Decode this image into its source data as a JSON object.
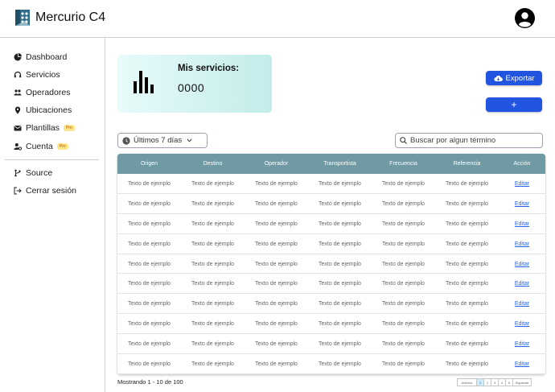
{
  "app": {
    "title": "Mercurio C4"
  },
  "sidebar": {
    "items": [
      {
        "label": "Dashboard",
        "icon": "pie-chart-icon",
        "badge": ""
      },
      {
        "label": "Servicios",
        "icon": "headset-icon",
        "badge": ""
      },
      {
        "label": "Operadores",
        "icon": "users-icon",
        "badge": ""
      },
      {
        "label": "Ubicaciones",
        "icon": "location-pin-icon",
        "badge": ""
      },
      {
        "label": "Plantillas",
        "icon": "envelope-icon",
        "badge": "Pro"
      },
      {
        "label": "Cuenta",
        "icon": "user-gear-icon",
        "badge": "Pro"
      }
    ],
    "footer_items": [
      {
        "label": "Source",
        "icon": "branch-icon"
      },
      {
        "label": "Cerrar sesión",
        "icon": "sign-out-icon"
      }
    ]
  },
  "stat": {
    "label": "Mis servicios:",
    "value": "0000"
  },
  "buttons": {
    "export_label": "Exportar",
    "add_label": "+"
  },
  "filter": {
    "value": "Últimos 7 días"
  },
  "search": {
    "placeholder": "Buscar por algun término"
  },
  "table": {
    "columns": [
      "Origen",
      "Destino",
      "Operador",
      "Transportista",
      "Frecuencia",
      "Referencia",
      "Acción"
    ],
    "rows": [
      [
        "Texto de ejemplo",
        "Texto de ejemplo",
        "Texto de ejemplo",
        "Texto de ejemplo",
        "Texto de ejemplo",
        "Texto de ejemplo",
        "Editar"
      ],
      [
        "Texto de ejemplo",
        "Texto de ejemplo",
        "Texto de ejemplo",
        "Texto de ejemplo",
        "Texto de ejemplo",
        "Texto de ejemplo",
        "Editar"
      ],
      [
        "Texto de ejemplo",
        "Texto de ejemplo",
        "Texto de ejemplo",
        "Texto de ejemplo",
        "Texto de ejemplo",
        "Texto de ejemplo",
        "Editar"
      ],
      [
        "Texto de ejemplo",
        "Texto de ejemplo",
        "Texto de ejemplo",
        "Texto de ejemplo",
        "Texto de ejemplo",
        "Texto de ejemplo",
        "Editar"
      ],
      [
        "Texto de ejemplo",
        "Texto de ejemplo",
        "Texto de ejemplo",
        "Texto de ejemplo",
        "Texto de ejemplo",
        "Texto de ejemplo",
        "Editar"
      ],
      [
        "Texto de ejemplo",
        "Texto de ejemplo",
        "Texto de ejemplo",
        "Texto de ejemplo",
        "Texto de ejemplo",
        "Texto de ejemplo",
        "Editar"
      ],
      [
        "Texto de ejemplo",
        "Texto de ejemplo",
        "Texto de ejemplo",
        "Texto de ejemplo",
        "Texto de ejemplo",
        "Texto de ejemplo",
        "Editar"
      ],
      [
        "Texto de ejemplo",
        "Texto de ejemplo",
        "Texto de ejemplo",
        "Texto de ejemplo",
        "Texto de ejemplo",
        "Texto de ejemplo",
        "Editar"
      ],
      [
        "Texto de ejemplo",
        "Texto de ejemplo",
        "Texto de ejemplo",
        "Texto de ejemplo",
        "Texto de ejemplo",
        "Texto de ejemplo",
        "Editar"
      ],
      [
        "Texto de ejemplo",
        "Texto de ejemplo",
        "Texto de ejemplo",
        "Texto de ejemplo",
        "Texto de ejemplo",
        "Texto de ejemplo",
        "Editar"
      ]
    ]
  },
  "pagination": {
    "summary": "Mostrando 1 - 10 de 100",
    "prev_label": "Anterior",
    "pages": [
      "1",
      "2",
      "3",
      "4",
      "5"
    ],
    "current_page": "1",
    "next_label": "Siguiente"
  },
  "colors": {
    "accent": "#2155e0",
    "table_header": "#6f99a3",
    "card_start": "#e7fbfa",
    "card_end": "#c3ecea",
    "link": "#2563eb"
  }
}
